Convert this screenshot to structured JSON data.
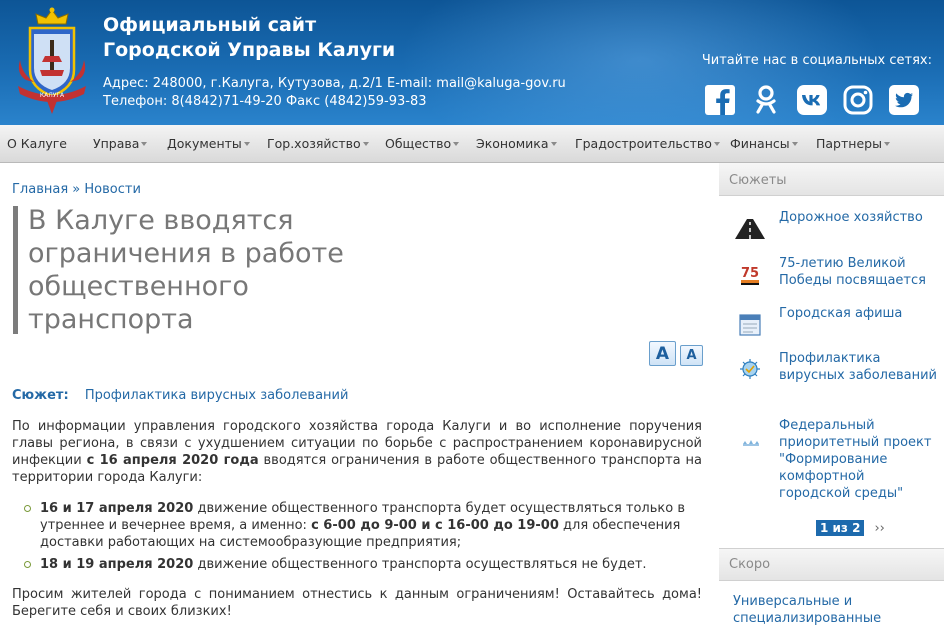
{
  "header": {
    "title_line1": "Официальный сайт",
    "title_line2": "Городской Управы Калуги",
    "address": "Адрес: 248000, г.Калуга, Кутузова, д.2/1 E-mail: mail@kaluga-gov.ru",
    "phone": "Телефон: 8(4842)71-49-20 Факс (4842)59-93-83",
    "social_label": "Читайте нас в социальных сетях:",
    "socials": [
      "facebook-icon",
      "odnoklassniki-icon",
      "vk-icon",
      "instagram-icon",
      "twitter-icon"
    ]
  },
  "nav": {
    "items": [
      {
        "label": "О Калуге"
      },
      {
        "label": "Управа"
      },
      {
        "label": "Документы"
      },
      {
        "label": "Гор.хозяйство"
      },
      {
        "label": "Общество"
      },
      {
        "label": "Экономика"
      },
      {
        "label": "Градостроительство"
      },
      {
        "label": "Финансы"
      },
      {
        "label": "Партнеры"
      }
    ]
  },
  "breadcrumb": {
    "home": "Главная",
    "separator": "»",
    "current": "Новости"
  },
  "article": {
    "title": "В Калуге вводятся ограничения в работе общественного транспорта",
    "font_increase": "A",
    "font_decrease": "A",
    "topic_label": "Сюжет:",
    "topic_value": "Профилактика вирусных заболеваний",
    "intro_part1": "По информации управления городского хозяйства города Калуги и во исполнение поручения главы региона, в связи с ухудшением ситуации по борьбе с распространением коронавирусной инфекции ",
    "intro_bold": "с 16 апреля 2020 года",
    "intro_part2": " вводятся ограничения в работе общественного транспорта на территории города Калуги:",
    "bullet1_bold1": "16 и 17 апреля 2020",
    "bullet1_text1": " движение общественного транспорта будет осуществляться только в утреннее и вечернее время, а именно: ",
    "bullet1_bold2": "с 6-00 до 9-00 и с 16-00 до 19-00",
    "bullet1_text2": " для обеспечения доставки работающих на системообразующие предприятия;",
    "bullet2_bold": "18 и 19 апреля 2020",
    "bullet2_text": " движение  общественного транспорта  осуществляться не будет.",
    "closing": "Просим жителей города с пониманием отнестись к данным ограничениям! Оставайтесь дома! Берегите себя и своих близких!"
  },
  "sidebar": {
    "stories_title": "Сюжеты",
    "stories": [
      {
        "label": "Дорожное хозяйство",
        "icon": "road-icon"
      },
      {
        "label": "75-летию Великой Победы посвящается",
        "icon": "victory-75-icon"
      },
      {
        "label": "Городская афиша",
        "icon": "calendar-icon"
      },
      {
        "label": "Профилактика вирусных заболеваний",
        "icon": "virus-prevention-icon"
      },
      {
        "label": "Федеральный приоритетный проект \"Формирование комфортной городской среды\"",
        "icon": "city-environment-icon"
      }
    ],
    "pager_current": "1 из 2",
    "pager_next": "››",
    "soon_title": "Скоро",
    "soon_item": "Универсальные и специализированные"
  }
}
